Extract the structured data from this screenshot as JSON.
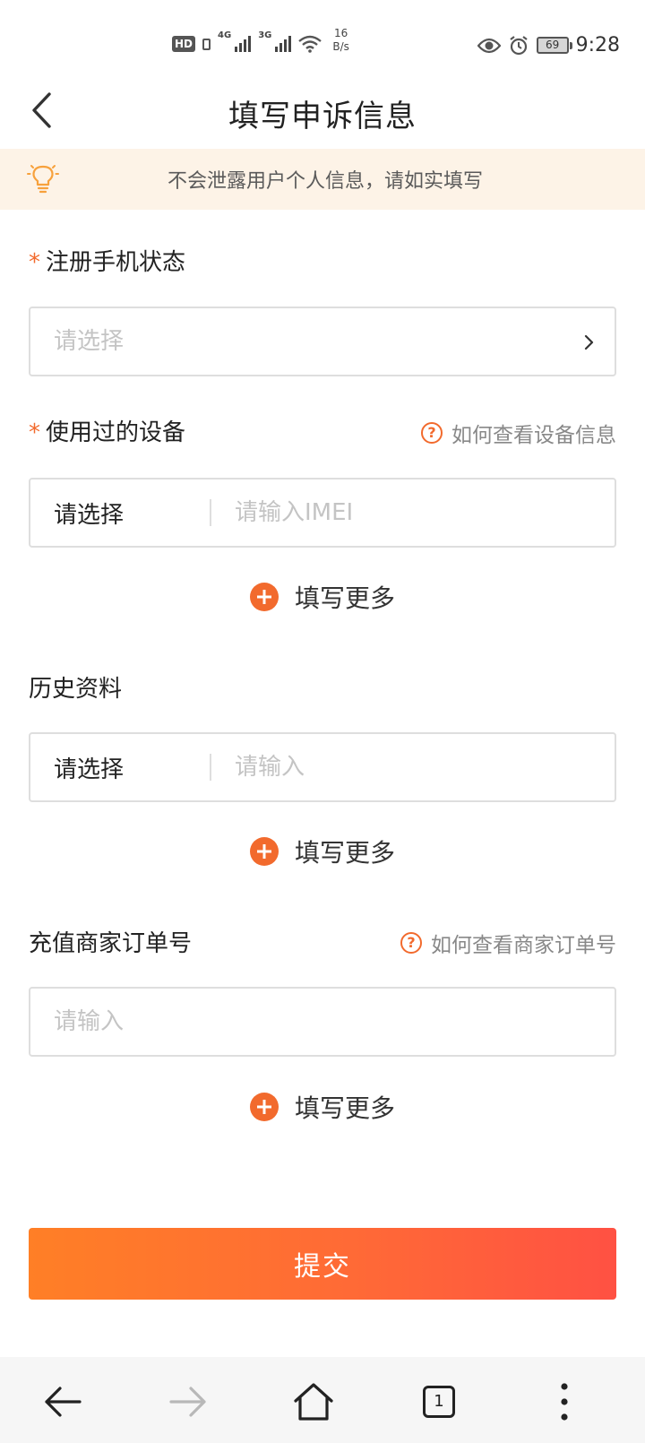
{
  "status_bar": {
    "hd": "HD",
    "net1": "4G",
    "net2": "3G",
    "speed_value": "16",
    "speed_unit": "B/s",
    "battery": "69",
    "time": "9:28"
  },
  "header": {
    "title": "填写申诉信息",
    "back_icon": "chevron-left-icon"
  },
  "notice": {
    "icon": "lightbulb-icon",
    "text": "不会泄露用户个人信息，请如实填写"
  },
  "form": {
    "phone_status": {
      "required_mark": "*",
      "label": "注册手机状态",
      "placeholder": "请选择"
    },
    "devices": {
      "required_mark": "*",
      "label": "使用过的设备",
      "help_text": "如何查看设备信息",
      "select_value": "请选择",
      "input_placeholder": "请输入IMEI",
      "more_label": "填写更多"
    },
    "history": {
      "label": "历史资料",
      "select_value": "请选择",
      "input_placeholder": "请输入",
      "more_label": "填写更多"
    },
    "order": {
      "label": "充值商家订单号",
      "help_text": "如何查看商家订单号",
      "input_placeholder": "请输入",
      "more_label": "填写更多"
    },
    "submit_label": "提交",
    "accent_color": "#f26a2d"
  },
  "bottom_nav": {
    "tab_count": "1",
    "icons": [
      "back-arrow-icon",
      "forward-arrow-icon",
      "home-icon",
      "tabs-icon",
      "more-vertical-icon"
    ]
  }
}
